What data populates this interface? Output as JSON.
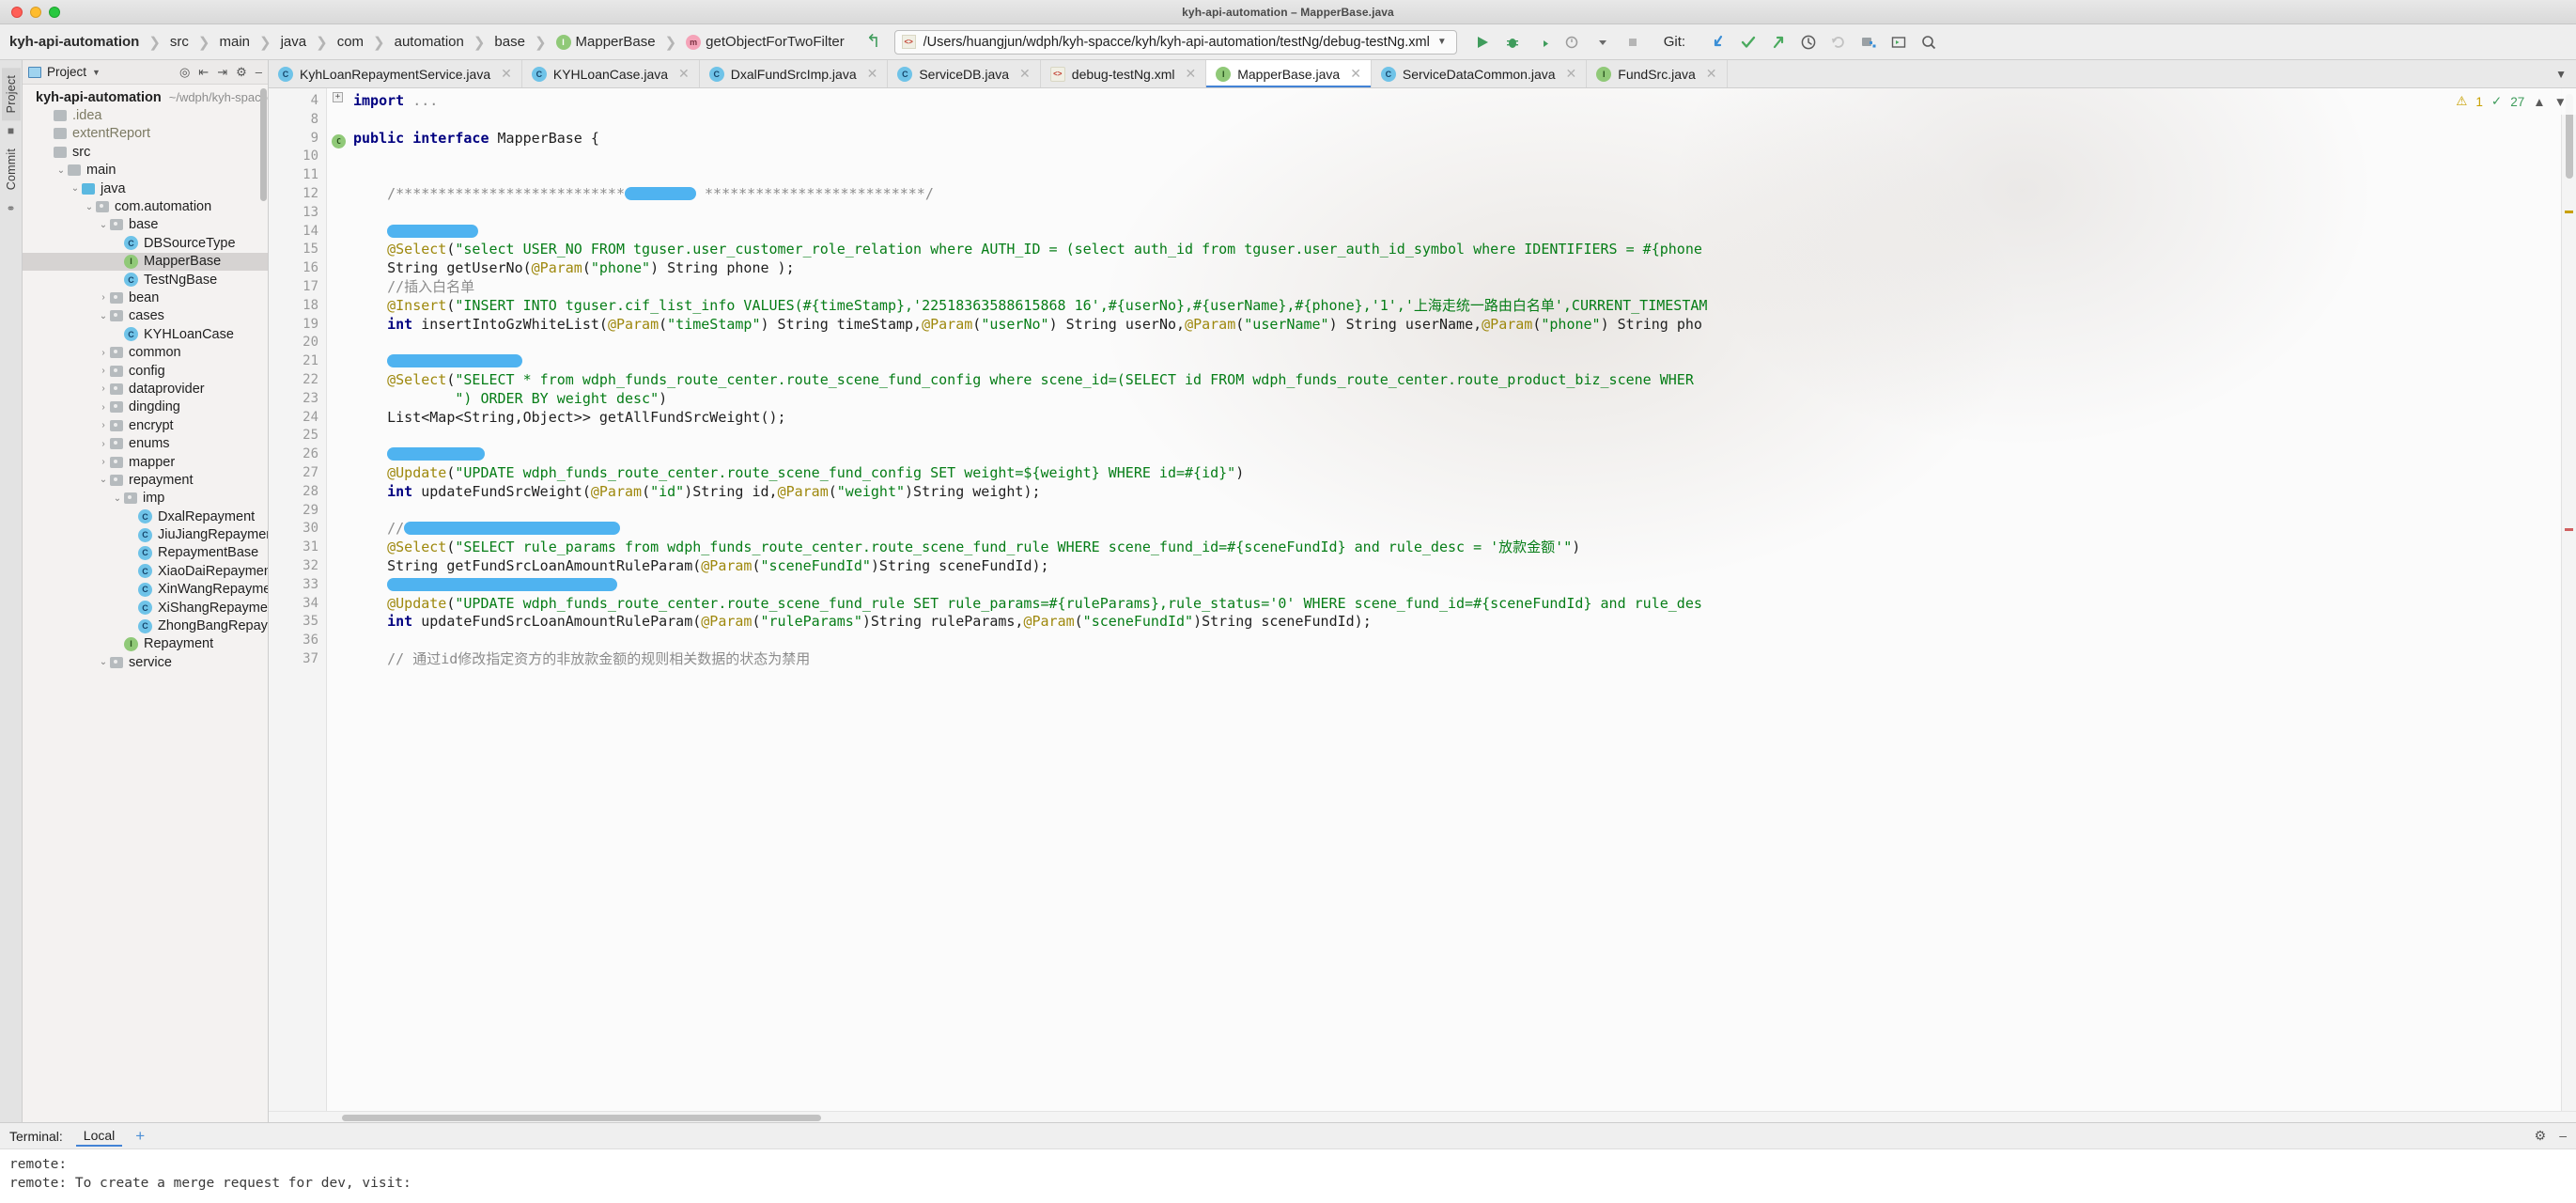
{
  "window": {
    "title": "kyh-api-automation – MapperBase.java"
  },
  "breadcrumb": {
    "items": [
      {
        "label": "kyh-api-automation",
        "icon": ""
      },
      {
        "label": "src",
        "icon": ""
      },
      {
        "label": "main",
        "icon": ""
      },
      {
        "label": "java",
        "icon": ""
      },
      {
        "label": "com",
        "icon": ""
      },
      {
        "label": "automation",
        "icon": ""
      },
      {
        "label": "base",
        "icon": ""
      },
      {
        "label": "MapperBase",
        "icon": "interface-icon"
      },
      {
        "label": "getObjectForTwoFilter",
        "icon": "method-icon"
      }
    ]
  },
  "toolbar": {
    "run_config": "/Users/huangjun/wdph/kyh-spacce/kyh/kyh-api-automation/testNg/debug-testNg.xml",
    "git_label": "Git:",
    "icons": [
      "run-icon",
      "debug-icon",
      "run-coverage-icon",
      "profile-icon",
      "stop-icon",
      "git-update-icon",
      "git-commit-icon",
      "git-push-icon",
      "git-history-icon",
      "git-rollback-icon",
      "project-structure-icon",
      "terminal-icon",
      "search-icon"
    ]
  },
  "sidebar": {
    "vertical_tabs": [
      "Project",
      "Commit"
    ],
    "panel_title": "Project",
    "head_icons": [
      "locate-icon",
      "collapse-icon",
      "expand-icon",
      "gear-icon",
      "hide-icon"
    ],
    "root": {
      "label": "kyh-api-automation",
      "path": "~/wdph/kyh-spacce"
    },
    "tree": [
      {
        "label": ".idea",
        "indent": 1,
        "twisty": "",
        "icon": "folder-gray",
        "dim": true
      },
      {
        "label": "extentReport",
        "indent": 1,
        "twisty": "",
        "icon": "folder-gray",
        "dim": true
      },
      {
        "label": "src",
        "indent": 1,
        "twisty": "",
        "icon": "folder-gray",
        "dim": false
      },
      {
        "label": "main",
        "indent": 2,
        "twisty": "v",
        "icon": "folder-gray",
        "dim": false
      },
      {
        "label": "java",
        "indent": 3,
        "twisty": "v",
        "icon": "folder-blue",
        "dim": false
      },
      {
        "label": "com.automation",
        "indent": 4,
        "twisty": "v",
        "icon": "folder-pkg",
        "dim": false
      },
      {
        "label": "base",
        "indent": 5,
        "twisty": "v",
        "icon": "folder-pkg",
        "dim": false
      },
      {
        "label": "DBSourceType",
        "indent": 6,
        "twisty": "",
        "icon": "class-icon",
        "dim": false
      },
      {
        "label": "MapperBase",
        "indent": 6,
        "twisty": "",
        "icon": "interface-icon",
        "dim": false,
        "selected": true
      },
      {
        "label": "TestNgBase",
        "indent": 6,
        "twisty": "",
        "icon": "class-icon",
        "dim": false
      },
      {
        "label": "bean",
        "indent": 5,
        "twisty": ">",
        "icon": "folder-pkg",
        "dim": false
      },
      {
        "label": "cases",
        "indent": 5,
        "twisty": "v",
        "icon": "folder-pkg",
        "dim": false
      },
      {
        "label": "KYHLoanCase",
        "indent": 6,
        "twisty": "",
        "icon": "class-run-icon",
        "dim": false
      },
      {
        "label": "common",
        "indent": 5,
        "twisty": ">",
        "icon": "folder-pkg",
        "dim": false
      },
      {
        "label": "config",
        "indent": 5,
        "twisty": ">",
        "icon": "folder-pkg",
        "dim": false
      },
      {
        "label": "dataprovider",
        "indent": 5,
        "twisty": ">",
        "icon": "folder-pkg",
        "dim": false
      },
      {
        "label": "dingding",
        "indent": 5,
        "twisty": ">",
        "icon": "folder-pkg",
        "dim": false
      },
      {
        "label": "encrypt",
        "indent": 5,
        "twisty": ">",
        "icon": "folder-pkg",
        "dim": false
      },
      {
        "label": "enums",
        "indent": 5,
        "twisty": ">",
        "icon": "folder-pkg",
        "dim": false
      },
      {
        "label": "mapper",
        "indent": 5,
        "twisty": ">",
        "icon": "folder-pkg",
        "dim": false
      },
      {
        "label": "repayment",
        "indent": 5,
        "twisty": "v",
        "icon": "folder-pkg",
        "dim": false
      },
      {
        "label": "imp",
        "indent": 6,
        "twisty": "v",
        "icon": "folder-pkg",
        "dim": false
      },
      {
        "label": "DxalRepayment",
        "indent": 7,
        "twisty": "",
        "icon": "class-icon",
        "dim": false
      },
      {
        "label": "JiuJiangRepayment",
        "indent": 7,
        "twisty": "",
        "icon": "class-icon",
        "dim": false
      },
      {
        "label": "RepaymentBase",
        "indent": 7,
        "twisty": "",
        "icon": "class-icon",
        "dim": false
      },
      {
        "label": "XiaoDaiRepayment",
        "indent": 7,
        "twisty": "",
        "icon": "class-icon",
        "dim": false
      },
      {
        "label": "XinWangRepayment",
        "indent": 7,
        "twisty": "",
        "icon": "class-icon",
        "dim": false
      },
      {
        "label": "XiShangRepayment",
        "indent": 7,
        "twisty": "",
        "icon": "class-icon",
        "dim": false
      },
      {
        "label": "ZhongBangRepayment",
        "indent": 7,
        "twisty": "",
        "icon": "class-icon",
        "dim": false
      },
      {
        "label": "Repayment",
        "indent": 6,
        "twisty": "",
        "icon": "interface-icon",
        "dim": false
      },
      {
        "label": "service",
        "indent": 5,
        "twisty": "v",
        "icon": "folder-pkg",
        "dim": false
      }
    ]
  },
  "tabs": [
    {
      "label": "KyhLoanRepaymentService.java",
      "icon": "class-icon",
      "active": false
    },
    {
      "label": "KYHLoanCase.java",
      "icon": "class-run-icon",
      "active": false
    },
    {
      "label": "DxalFundSrcImp.java",
      "icon": "class-icon",
      "active": false
    },
    {
      "label": "ServiceDB.java",
      "icon": "class-icon",
      "active": false
    },
    {
      "label": "debug-testNg.xml",
      "icon": "xml-icon",
      "active": false
    },
    {
      "label": "MapperBase.java",
      "icon": "interface-icon",
      "active": true
    },
    {
      "label": "ServiceDataCommon.java",
      "icon": "class-icon",
      "active": false
    },
    {
      "label": "FundSrc.java",
      "icon": "interface-icon",
      "active": false
    }
  ],
  "inspection": {
    "warnings": "1",
    "checks": "27"
  },
  "code": {
    "lines": [
      {
        "n": "4",
        "html": "<span class='foldmark'>+</span><span class='kw'>import</span> <span class='cmt'>...</span>",
        "fold": true
      },
      {
        "n": "8",
        "html": ""
      },
      {
        "n": "9",
        "html": "<span class='kw'>public interface</span> MapperBase {",
        "gutter_icons": [
          "class-gutter-icon",
          "implemented-icon"
        ]
      },
      {
        "n": "10",
        "html": ""
      },
      {
        "n": "11",
        "html": ""
      },
      {
        "n": "12",
        "html": "    <span class='cmt'>/***************************</span><span class='blue-bar' style='width:76px'></span><span class='cmt'> **************************/</span>"
      },
      {
        "n": "13",
        "html": ""
      },
      {
        "n": "14",
        "html": "    <span class='blue-bar' style='width:97px'></span>"
      },
      {
        "n": "15",
        "html": "    <span class='ann'>@Select</span>(<span class='str'>\"select USER_NO FROM tguser.user_customer_role_relation where AUTH_ID = (select auth_id from tguser.user_auth_id_symbol where IDENTIFIERS = #{phone</span>"
      },
      {
        "n": "16",
        "html": "    String getUserNo(<span class='ann'>@Param</span>(<span class='str'>\"phone\"</span>) String phone );"
      },
      {
        "n": "17",
        "html": "    <span class='cmt'>//插入白名单</span>"
      },
      {
        "n": "18",
        "html": "    <span class='ann'>@Insert</span>(<span class='str'>\"INSERT INTO tguser.cif_list_info VALUES(#{timeStamp},'22518363588615868 16',#{userNo},#{userName},#{phone},'1','上海走统一路由白名单',CURRENT_TIMESTAM</span>"
      },
      {
        "n": "19",
        "html": "    <span class='kw'>int</span> insertIntoGzWhiteList(<span class='ann'>@Param</span>(<span class='str'>\"timeStamp\"</span>) String timeStamp,<span class='ann'>@Param</span>(<span class='str'>\"userNo\"</span>) String userNo,<span class='ann'>@Param</span>(<span class='str'>\"userName\"</span>) String userName,<span class='ann'>@Param</span>(<span class='str'>\"phone\"</span>) String pho"
      },
      {
        "n": "20",
        "html": ""
      },
      {
        "n": "21",
        "html": "    <span class='blue-bar' style='width:144px'></span>"
      },
      {
        "n": "22",
        "html": "    <span class='ann'>@Select</span>(<span class='str'>\"SELECT * from wdph_funds_route_center.route_scene_fund_config where scene_id=(SELECT id FROM wdph_funds_route_center.route_product_biz_scene WHER</span>"
      },
      {
        "n": "23",
        "html": "            <span class='str'>\") ORDER BY weight desc\"</span>)"
      },
      {
        "n": "24",
        "html": "    List&lt;Map&lt;String,Object&gt;&gt; getAllFundSrcWeight();"
      },
      {
        "n": "25",
        "html": ""
      },
      {
        "n": "26",
        "html": "    <span class='blue-bar' style='width:104px'></span>"
      },
      {
        "n": "27",
        "html": "    <span class='ann'>@Update</span>(<span class='str'>\"UPDATE wdph_funds_route_center.route_scene_fund_config SET weight=${weight} WHERE id=#{id}\"</span>)"
      },
      {
        "n": "28",
        "html": "    <span class='kw'>int</span> updateFundSrcWeight(<span class='ann'>@Param</span>(<span class='str'>\"id\"</span>)String id,<span class='ann'>@Param</span>(<span class='str'>\"weight\"</span>)String weight);"
      },
      {
        "n": "29",
        "html": ""
      },
      {
        "n": "30",
        "html": "    <span class='cmt'>//</span><span class='blue-bar' style='width:230px'></span>"
      },
      {
        "n": "31",
        "html": "    <span class='ann'>@Select</span>(<span class='str'>\"SELECT rule_params from wdph_funds_route_center.route_scene_fund_rule WHERE scene_fund_id=#{sceneFundId} and rule_desc = '放款金额'\"</span>)"
      },
      {
        "n": "32",
        "html": "    String getFundSrcLoanAmountRuleParam(<span class='ann'>@Param</span>(<span class='str'>\"sceneFundId\"</span>)String sceneFundId);"
      },
      {
        "n": "33",
        "html": "    <span class='blue-bar' style='width:245px'></span>"
      },
      {
        "n": "34",
        "html": "    <span class='ann'>@Update</span>(<span class='str'>\"UPDATE wdph_funds_route_center.route_scene_fund_rule SET rule_params=#{ruleParams},rule_status='0' WHERE scene_fund_id=#{sceneFundId} and rule_des</span>"
      },
      {
        "n": "35",
        "html": "    <span class='kw'>int</span> updateFundSrcLoanAmountRuleParam(<span class='ann'>@Param</span>(<span class='str'>\"ruleParams\"</span>)String ruleParams,<span class='ann'>@Param</span>(<span class='str'>\"sceneFundId\"</span>)String sceneFundId);"
      },
      {
        "n": "36",
        "html": ""
      },
      {
        "n": "37",
        "html": "    <span class='cmt'>// 通过id修改指定资方的非放款金额的规则相关数据的状态为禁用</span>"
      }
    ]
  },
  "terminal": {
    "label": "Terminal:",
    "tab": "Local",
    "add": "+",
    "tools": [
      "gear-icon",
      "minimize-icon"
    ],
    "output": [
      "remote:",
      "remote: To create a merge request for dev, visit:"
    ]
  }
}
